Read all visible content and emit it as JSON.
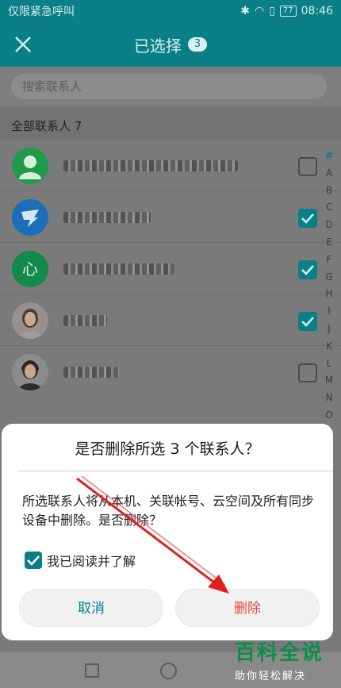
{
  "status_bar": {
    "carrier": "仅限紧急呼叫",
    "battery": "77",
    "time": "08:46"
  },
  "header": {
    "title": "已选择",
    "count": "3"
  },
  "search": {
    "placeholder": "搜索联系人"
  },
  "section": {
    "label": "全部联系人 7"
  },
  "contacts": [
    {
      "avatar": "default-person",
      "name_width": 220,
      "checked": false
    },
    {
      "avatar": "dingtalk",
      "name_width": 110,
      "checked": true
    },
    {
      "avatar": "green-xin",
      "avatar_text": "心",
      "name_width": 140,
      "checked": true
    },
    {
      "avatar": "woman-photo",
      "name_width": 55,
      "checked": true
    },
    {
      "avatar": "headset-photo",
      "name_width": 70,
      "checked": false
    }
  ],
  "index_letters": [
    "#",
    "A",
    "B",
    "C",
    "D",
    "E",
    "F",
    "G",
    "H",
    "I",
    "J",
    "K",
    "L",
    "M",
    "N",
    "O"
  ],
  "dialog": {
    "title": "是否删除所选 3 个联系人？",
    "message": "所选联系人将从本机、关联帐号、云空间及所有同步设备中删除。是否删除？",
    "agree_label": "我已阅读并了解",
    "agree_checked": true,
    "cancel_label": "取消",
    "delete_label": "删除"
  },
  "watermark": {
    "main": "百科全说",
    "sub": "助你轻松解决"
  },
  "colors": {
    "primary": "#0b7f88",
    "danger": "#e0483a",
    "arrow": "#e02020"
  }
}
